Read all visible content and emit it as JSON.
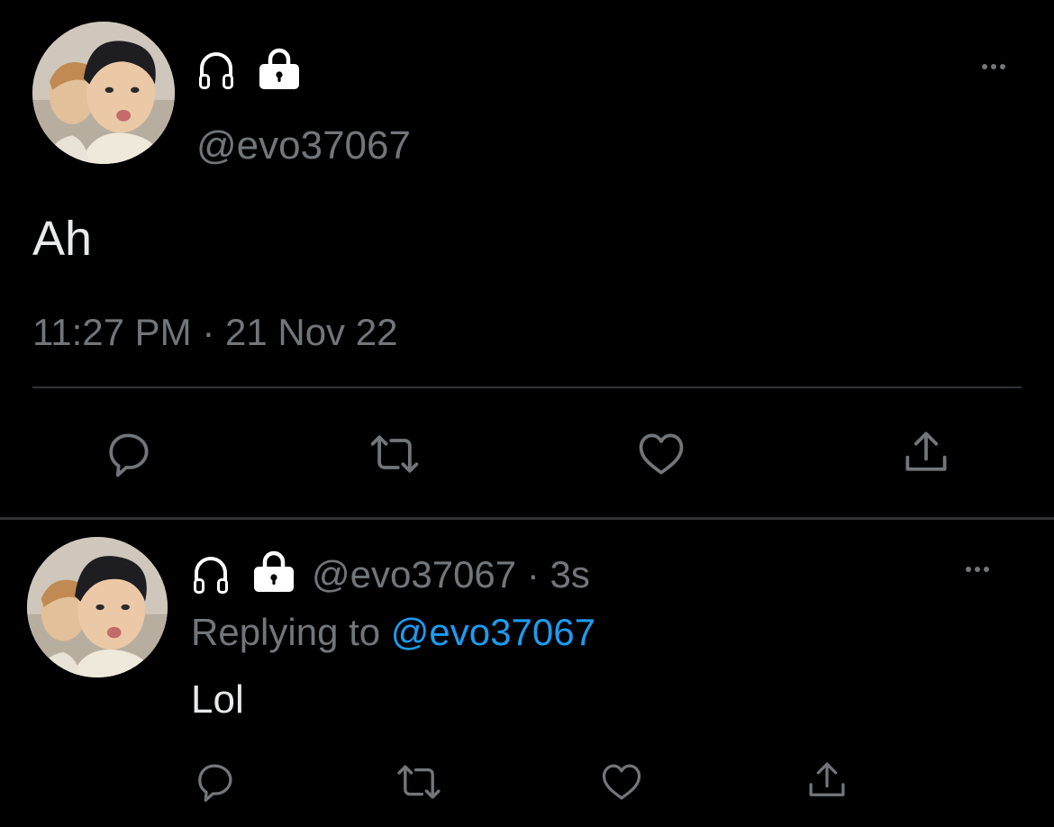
{
  "main_tweet": {
    "handle": "@evo37067",
    "text": "Ah",
    "timestamp": "11:27 PM · 21 Nov 22",
    "icons": [
      "headphones-icon",
      "lock-icon"
    ],
    "actions": [
      "reply-icon",
      "retweet-icon",
      "like-icon",
      "share-icon"
    ]
  },
  "reply_tweet": {
    "handle": "@evo37067",
    "separator": "·",
    "time_ago": "3s",
    "replying_to_label": "Replying to",
    "replying_to_handle": "@evo37067",
    "text": "Lol",
    "icons": [
      "headphones-icon",
      "lock-icon"
    ],
    "actions": [
      "reply-icon",
      "retweet-icon",
      "like-icon",
      "share-icon"
    ]
  },
  "colors": {
    "background": "#000000",
    "text": "#e7e9ea",
    "muted": "#71767b",
    "link": "#1d9bf0",
    "divider": "#2f3336"
  }
}
